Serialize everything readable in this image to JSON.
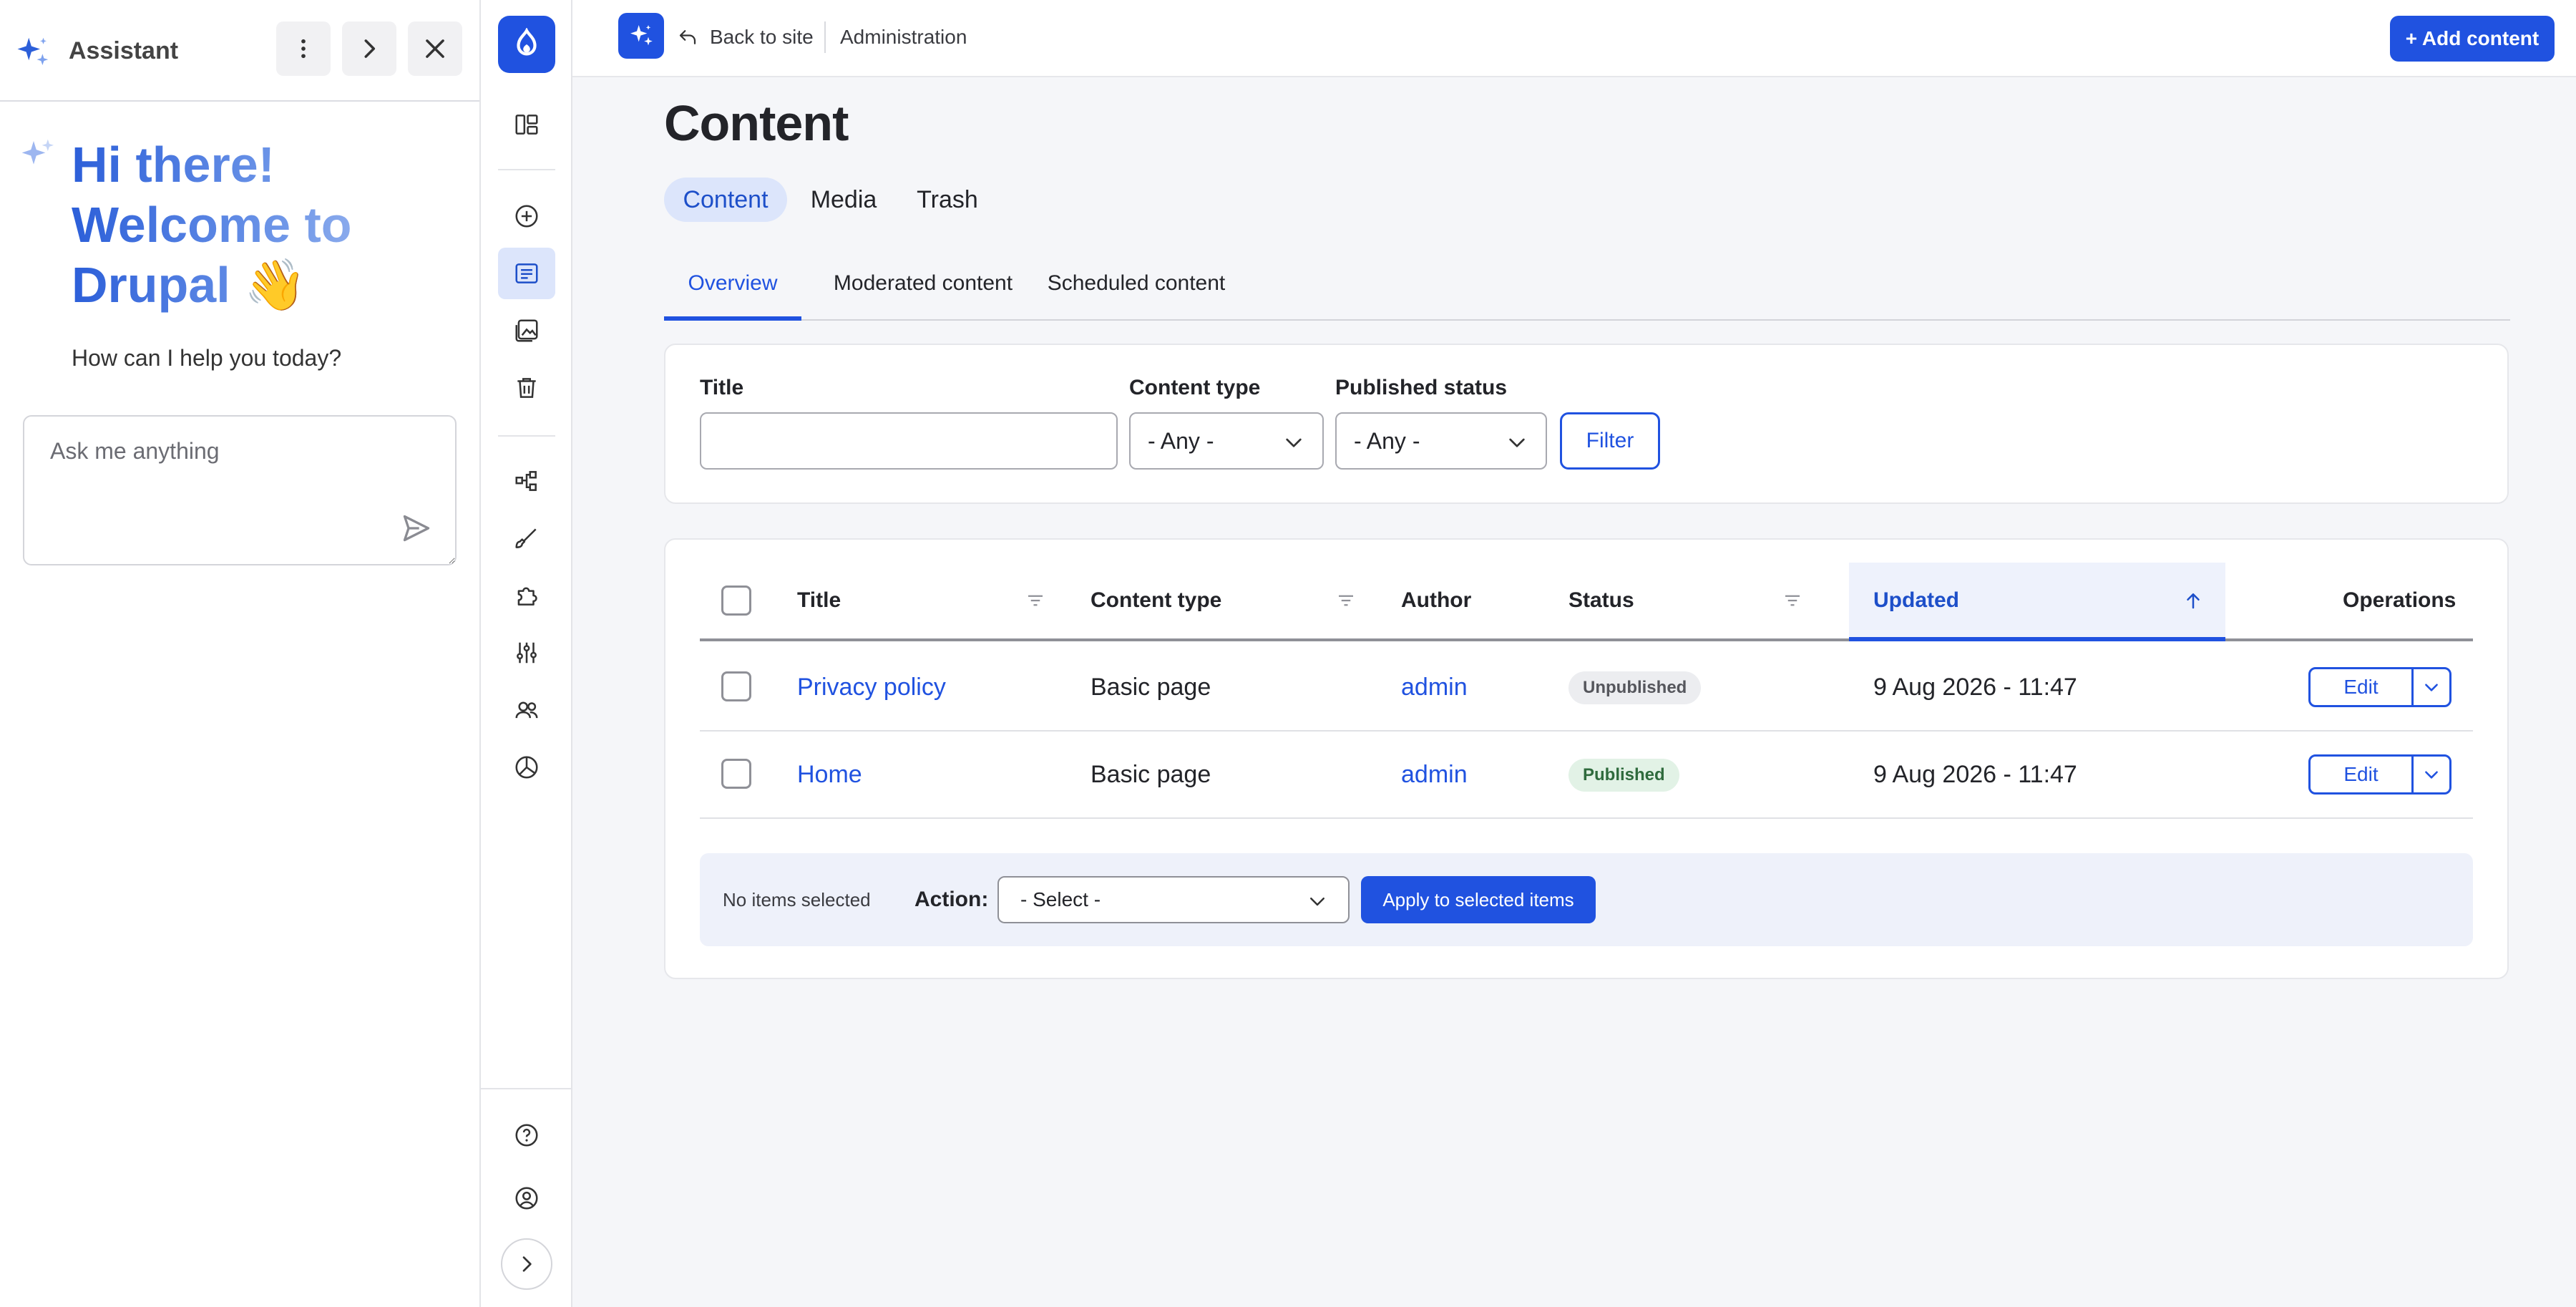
{
  "assistant": {
    "title": "Assistant",
    "greeting": [
      "Hi there!",
      "Welcome to",
      "Drupal"
    ],
    "greeting_emoji": "👋",
    "subtitle": "How can I help you today?",
    "input_placeholder": "Ask me anything"
  },
  "topbar": {
    "back_label": "Back to site",
    "breadcrumb": "Administration",
    "add_content_label": "+ Add content"
  },
  "page": {
    "title": "Content",
    "primary_tabs": [
      "Content",
      "Media",
      "Trash"
    ],
    "secondary_tabs": [
      "Overview",
      "Moderated content",
      "Scheduled content"
    ]
  },
  "filters": {
    "title_label": "Title",
    "title_value": "",
    "content_type_label": "Content type",
    "content_type_value": "- Any -",
    "status_label": "Published status",
    "status_value": "- Any -",
    "filter_button": "Filter"
  },
  "table": {
    "columns": [
      "Title",
      "Content type",
      "Author",
      "Status",
      "Updated",
      "Operations"
    ],
    "rows": [
      {
        "title": "Privacy policy",
        "type": "Basic page",
        "author": "admin",
        "status": "Unpublished",
        "updated": "9 Aug 2026 - 11:47",
        "op": "Edit"
      },
      {
        "title": "Home",
        "type": "Basic page",
        "author": "admin",
        "status": "Published",
        "updated": "9 Aug 2026 - 11:47",
        "op": "Edit"
      }
    ]
  },
  "bulk": {
    "status": "No items selected",
    "action_label": "Action:",
    "select_value": "- Select -",
    "apply_label": "Apply to selected items"
  },
  "colors": {
    "accent": "#2052e0",
    "accent_light": "#dce5fb",
    "published_bg": "#e2f2e6",
    "unpublished_bg": "#ecedf0"
  }
}
